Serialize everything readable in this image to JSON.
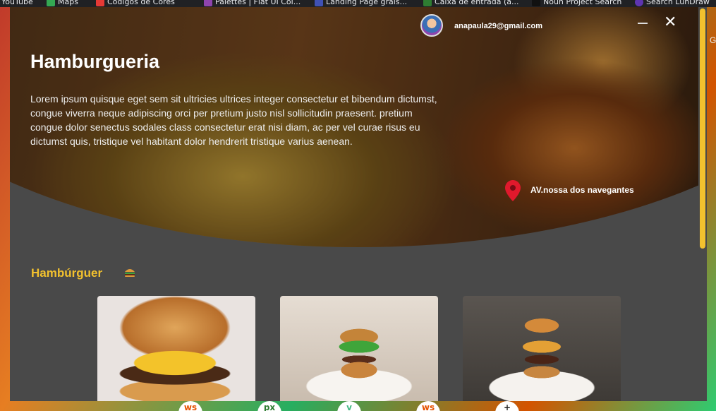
{
  "bookmarks": [
    {
      "label": "YouTube",
      "color": "#ff0000"
    },
    {
      "label": "Maps",
      "color": "#34a853"
    },
    {
      "label": "Códigos de Cores",
      "color": "#e53935"
    },
    {
      "label": "Palettes | Flat UI Col...",
      "color": "#8e44ad"
    },
    {
      "label": "Landing Page grais...",
      "color": "#3f51b5"
    },
    {
      "label": "Caixa de entrada (a...",
      "color": "#2e7d32"
    },
    {
      "label": "Noun Project Search",
      "color": "#111111"
    },
    {
      "label": "Search LunDraw",
      "color": "#5e35b1"
    }
  ],
  "side_letter": "G",
  "header": {
    "email": "anapaula29@gmail.com",
    "minimize_label": "—",
    "close_label": "✕"
  },
  "hero": {
    "title": "Hamburgueria",
    "description": "Lorem ipsum quisque eget sem sit ultricies ultrices integer consectetur et bibendum dictumst, congue viverra neque adipiscing orci per pretium justo nisl sollicitudin praesent. pretium congue dolor senectus sodales class consectetur erat nisi diam, ac per vel curae risus eu dictumst quis, tristique vel habitant dolor hendrerit tristique varius aenean.",
    "address": "AV.nossa dos navegantes"
  },
  "section": {
    "title": "Hambúrguer",
    "icon": "burger-icon"
  },
  "cards": [
    {
      "name": "hamburger-image-1"
    },
    {
      "name": "hamburger-image-2"
    },
    {
      "name": "hamburger-image-3"
    }
  ],
  "dock": [
    "ws",
    "px",
    "v",
    "ws",
    "+"
  ],
  "colors": {
    "accent": "#f2c12e",
    "modal_bg": "#494949",
    "pin": "#e0192c"
  }
}
